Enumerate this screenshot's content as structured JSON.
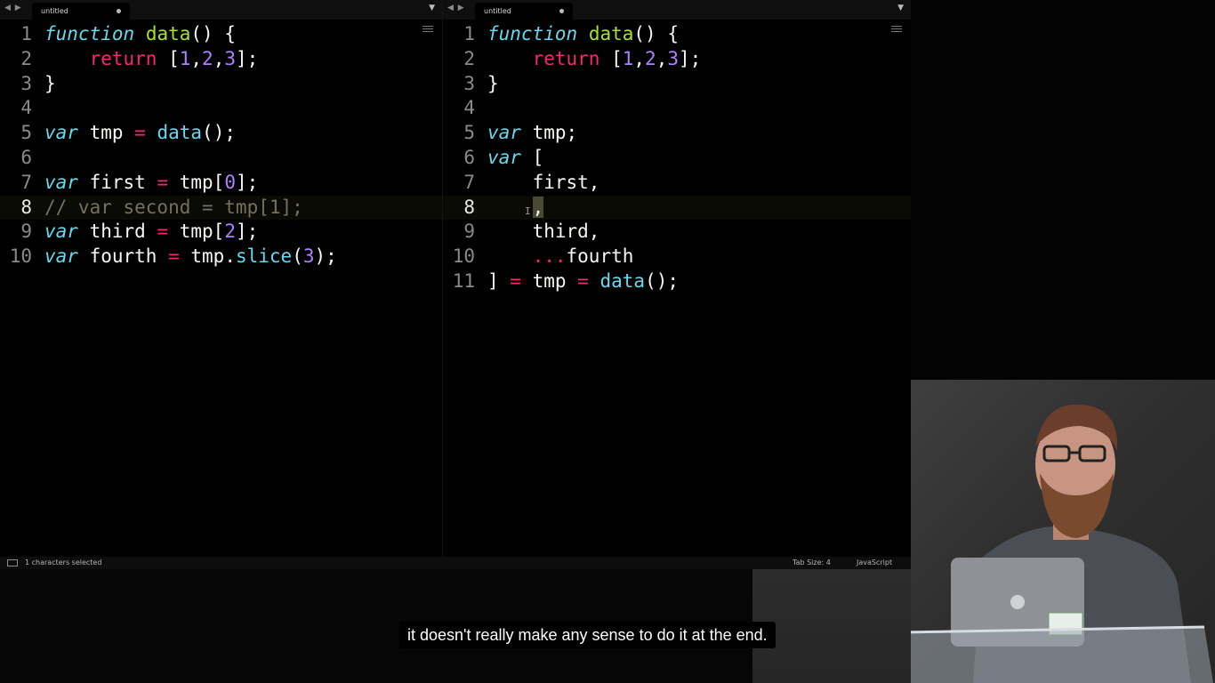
{
  "left_pane": {
    "tab_title": "untitled",
    "lines": [
      {
        "n": "1",
        "html": "<span class=\"kw\">function</span> <span class=\"fn\">data</span>() {"
      },
      {
        "n": "2",
        "html": "    <span class=\"ret\">return</span> [<span class=\"num\">1</span>,<span class=\"num\">2</span>,<span class=\"num\">3</span>];"
      },
      {
        "n": "3",
        "html": "}"
      },
      {
        "n": "4",
        "html": ""
      },
      {
        "n": "5",
        "html": "<span class=\"kw\">var</span> tmp <span class=\"op\">=</span> <span class=\"call\">data</span>();"
      },
      {
        "n": "6",
        "html": ""
      },
      {
        "n": "7",
        "html": "<span class=\"kw\">var</span> first <span class=\"op\">=</span> tmp[<span class=\"num\">0</span>];"
      },
      {
        "n": "8",
        "html": "<span class=\"cm\">// var second = tmp[1];</span>",
        "current": true
      },
      {
        "n": "9",
        "html": "<span class=\"kw\">var</span> third <span class=\"op\">=</span> tmp[<span class=\"num\">2</span>];"
      },
      {
        "n": "10",
        "html": "<span class=\"kw\">var</span> fourth <span class=\"op\">=</span> tmp.<span class=\"call\">slice</span>(<span class=\"num\">3</span>);"
      }
    ]
  },
  "right_pane": {
    "tab_title": "untitled",
    "lines": [
      {
        "n": "1",
        "html": "<span class=\"kw\">function</span> <span class=\"fn\">data</span>() {"
      },
      {
        "n": "2",
        "html": "    <span class=\"ret\">return</span> [<span class=\"num\">1</span>,<span class=\"num\">2</span>,<span class=\"num\">3</span>];"
      },
      {
        "n": "3",
        "html": "}"
      },
      {
        "n": "4",
        "html": ""
      },
      {
        "n": "5",
        "html": "<span class=\"kw\">var</span> tmp;"
      },
      {
        "n": "6",
        "html": "<span class=\"kw\">var</span> ["
      },
      {
        "n": "7",
        "html": "    first,"
      },
      {
        "n": "8",
        "html": "    <span class=\"sel\">,</span>",
        "current": true
      },
      {
        "n": "9",
        "html": "    third,"
      },
      {
        "n": "10",
        "html": "    <span class=\"op\">...</span>fourth"
      },
      {
        "n": "11",
        "html": "] <span class=\"op\">=</span> tmp <span class=\"op\">=</span> <span class=\"call\">data</span>();"
      }
    ]
  },
  "status_bar": {
    "selection": "1 characters selected",
    "tab_size": "Tab Size: 4",
    "syntax": "JavaScript"
  },
  "icons": {
    "nav": "left-right-arrows",
    "tab_modified": "dot",
    "tab_menu": "chevron-down",
    "minimap": "minimap",
    "status": "panel"
  },
  "subtitle": "it doesn't really make any sense to do it at the end.",
  "colors": {
    "keyword": "#66d9ef",
    "function_name": "#a6e22e",
    "operator": "#f92672",
    "number": "#ae81ff",
    "comment": "#75715e"
  }
}
